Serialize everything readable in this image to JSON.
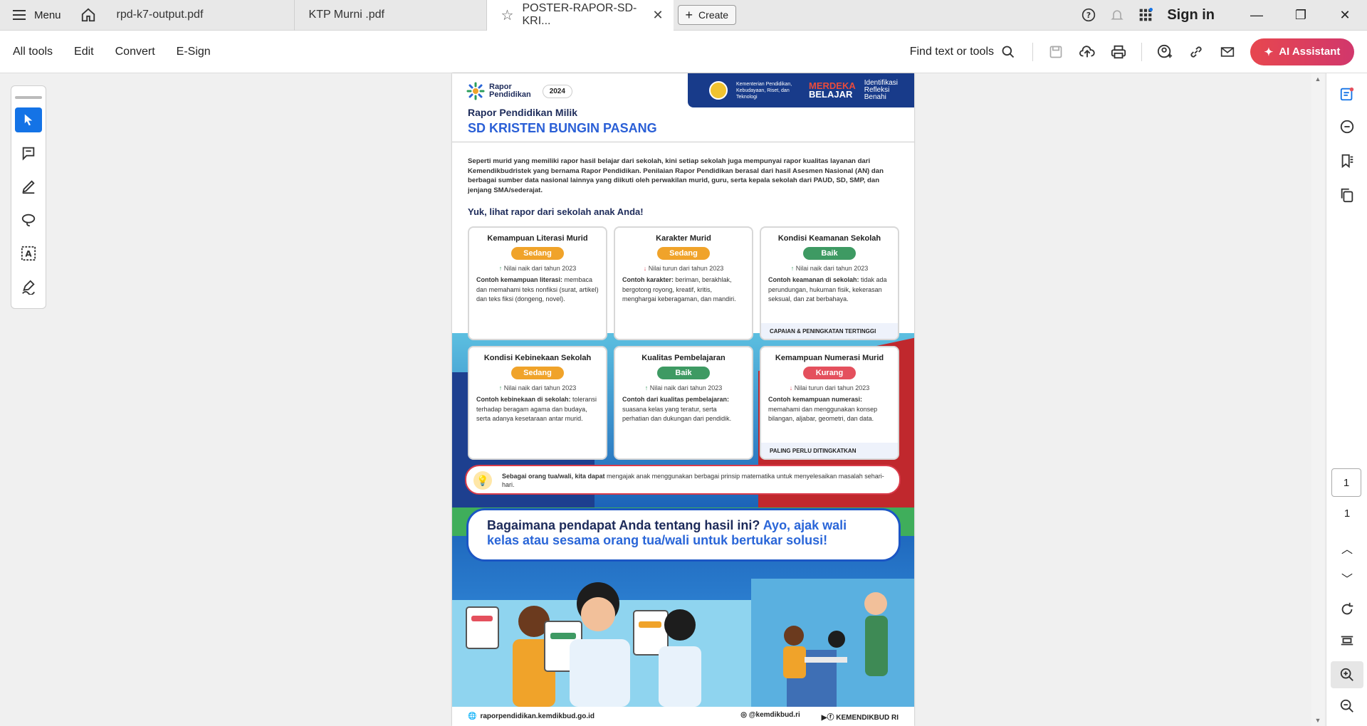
{
  "tabs": {
    "menu_label": "Menu",
    "items": [
      {
        "label": "rpd-k7-output.pdf"
      },
      {
        "label": "KTP Murni .pdf"
      },
      {
        "label": "POSTER-RAPOR-SD-KRI..."
      }
    ],
    "create_label": "Create",
    "sign_in": "Sign in"
  },
  "toolbar": {
    "all_tools": "All tools",
    "edit": "Edit",
    "convert": "Convert",
    "esign": "E-Sign",
    "find": "Find text or tools",
    "ai_assistant": "AI Assistant"
  },
  "pager": {
    "current": "1",
    "total": "1"
  },
  "poster": {
    "logo_line1": "Rapor",
    "logo_line2": "Pendidikan",
    "year": "2024",
    "kementerian": "Kementerian Pendidikan, Kebudayaan, Riset, dan Teknologi",
    "merdeka1": "MERDEKA",
    "merdeka2": "BELAJAR",
    "ikrb": "Identifikasi Refleksi Benahi",
    "owner": "Rapor Pendidikan Milik",
    "school": "SD KRISTEN BUNGIN PASANG",
    "intro": "Seperti murid yang memiliki rapor hasil belajar dari sekolah, kini setiap sekolah juga mempunyai rapor kualitas layanan dari Kemendikbudristek yang bernama Rapor Pendidikan. Penilaian Rapor Pendidikan berasal dari hasil Asesmen Nasional (AN) dan berbagai sumber data nasional lainnya yang diikuti oleh perwakilan murid, guru, serta kepala sekolah dari PAUD, SD, SMP, dan jenjang SMA/sederajat.",
    "yuk": "Yuk, lihat rapor dari sekolah anak Anda!",
    "cards": [
      {
        "title": "Kemampuan Literasi Murid",
        "status": "Sedang",
        "color": "#f0a32a",
        "trend_arrow": "↑",
        "trend": "Nilai naik dari tahun 2023",
        "desc_bold": "Contoh kemampuan literasi:",
        "desc": " membaca dan memahami teks nonfiksi (surat, artikel) dan teks fiksi (dongeng, novel).",
        "ribbon": ""
      },
      {
        "title": "Karakter Murid",
        "status": "Sedang",
        "color": "#f0a32a",
        "trend_arrow": "↓",
        "trend": "Nilai turun dari tahun 2023",
        "desc_bold": "Contoh karakter:",
        "desc": " beriman, berakhlak, bergotong royong, kreatif, kritis, menghargai keberagaman, dan mandiri.",
        "ribbon": ""
      },
      {
        "title": "Kondisi Keamanan Sekolah",
        "status": "Baik",
        "color": "#3e9a63",
        "trend_arrow": "↑",
        "trend": "Nilai naik dari tahun 2023",
        "desc_bold": "Contoh keamanan di sekolah:",
        "desc": " tidak ada perundungan, hukuman fisik, kekerasan seksual, dan zat berbahaya.",
        "ribbon": "CAPAIAN & PENINGKATAN TERTINGGI"
      },
      {
        "title": "Kondisi Kebinekaan Sekolah",
        "status": "Sedang",
        "color": "#f0a32a",
        "trend_arrow": "↑",
        "trend": "Nilai naik dari tahun 2023",
        "desc_bold": "Contoh kebinekaan di sekolah:",
        "desc": " toleransi terhadap beragam agama dan budaya, serta adanya kesetaraan antar murid.",
        "ribbon": ""
      },
      {
        "title": "Kualitas Pembelajaran",
        "status": "Baik",
        "color": "#3e9a63",
        "trend_arrow": "↑",
        "trend": "Nilai naik dari tahun 2023",
        "desc_bold": "Contoh dari kualitas pembelajaran:",
        "desc": " suasana kelas yang teratur, serta perhatian dan dukungan dari pendidik.",
        "ribbon": ""
      },
      {
        "title": "Kemampuan Numerasi Murid",
        "status": "Kurang",
        "color": "#e4505d",
        "trend_arrow": "↓",
        "trend": "Nilai turun dari tahun 2023",
        "desc_bold": "Contoh kemampuan numerasi:",
        "desc": " memahami dan menggunakan konsep bilangan, aljabar, geometri, dan data.",
        "ribbon": "PALING PERLU DITINGKATKAN"
      }
    ],
    "tip_bold": "Sebagai orang tua/wali, kita dapat",
    "tip": " mengajak anak menggunakan berbagai prinsip matematika untuk menyelesaikan masalah sehari-hari.",
    "ask_main": "Bagaimana pendapat Anda tentang hasil ini?",
    "ask_accent": " Ayo, ajak wali kelas atau sesama orang tua/wali untuk bertukar solusi!",
    "footer_site": "rapor­pendidikan.kemdikbud.go.id",
    "footer_ig": "@kemdikbud.ri",
    "footer_yt": "KEMENDIKBUD RI"
  }
}
